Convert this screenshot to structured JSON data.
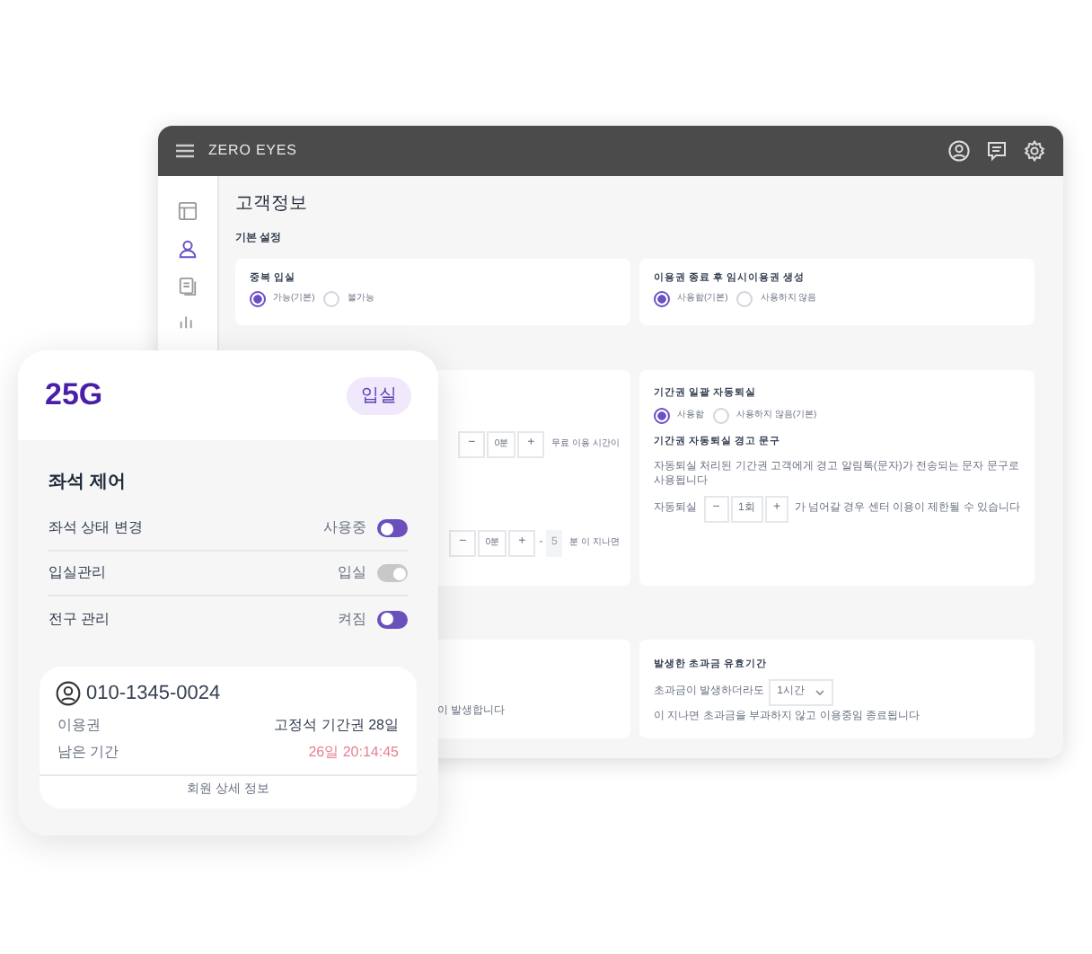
{
  "window": {
    "logo": "ZERO EYES",
    "page_title": "고객정보",
    "section_title": "기본 설정",
    "sidebar": [
      {
        "kind": "layout",
        "selected": false
      },
      {
        "kind": "user",
        "selected": true
      },
      {
        "kind": "docs",
        "selected": false
      },
      {
        "kind": "chart",
        "selected": false
      }
    ],
    "cards": [
      {
        "title": "중복 입실",
        "options": [
          {
            "label": "가능(기본)",
            "selected": true
          },
          {
            "label": "불가능",
            "selected": false
          }
        ]
      },
      {
        "title": "이용권 종료 후 임시이용권 생성",
        "options": [
          {
            "label": "사용함(기본)",
            "selected": true
          },
          {
            "label": "사용하지 않음",
            "selected": false
          }
        ]
      }
    ],
    "left_steppers": [
      {
        "minus": "−",
        "value": "0분",
        "plus": "+",
        "after": "무료 이용 시간이"
      },
      {
        "minus": "−",
        "value": "0분",
        "plus": "+",
        "dash": "-",
        "extra": "5",
        "after": "분 이 지나면"
      }
    ],
    "auto_exit": {
      "title": "기간권 일괄 자동퇴실",
      "options": [
        {
          "label": "사용함",
          "selected": true
        },
        {
          "label": "사용하지 않음(기본)",
          "selected": false
        }
      ],
      "warning_title": "기간권 자동퇴실 경고 문구",
      "description": "자동퇴실 처리된 기간권 고객에게 경고 알림톡(문자)가 전송되는 문자 문구로 사용됩니다",
      "stepper_label": "자동퇴실",
      "stepper_minus": "−",
      "stepper_value": "1회",
      "stepper_plus": "+",
      "stepper_after": "가 넘어갈 경우 센터 이용이 제한될 수 있습니다"
    },
    "left_note": "이 발생합니다",
    "overcharge": {
      "title": "발생한 초과금 유효기간",
      "before": "초과금이 발생하더라도",
      "select": "1시간",
      "after": "이 지나면 초과금을 부과하지 않고 이용중임 종료됩니다"
    }
  },
  "seat_card": {
    "seat": "25G",
    "badge": "입실",
    "section": "좌석 제어",
    "controls": [
      {
        "label": "좌석 상태 변경",
        "state": "사용중",
        "on": false,
        "disabled": false
      },
      {
        "label": "입실관리",
        "state": "입실",
        "on": true,
        "disabled": true
      },
      {
        "label": "전구 관리",
        "state": "켜짐",
        "on": false,
        "disabled": false
      }
    ],
    "member": {
      "phone": "010-1345-0024",
      "rows": [
        {
          "label": "이용권",
          "value": "고정석 기간권 28일",
          "highlight": false
        },
        {
          "label": "남은 기간",
          "value": "26일 20:14:45",
          "highlight": true
        }
      ],
      "link": "회원 상세 정보"
    }
  }
}
